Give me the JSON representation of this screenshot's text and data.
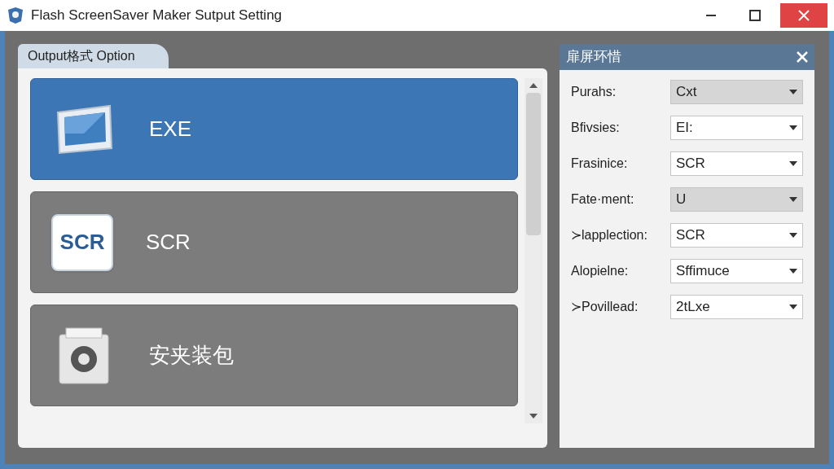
{
  "window": {
    "title": "Flash ScreenSaver Maker Sutput Setting"
  },
  "output_panel": {
    "tab": "Output格式 Option",
    "options": [
      {
        "kind": "monitor",
        "label": "EXE",
        "selected": true
      },
      {
        "kind": "scr",
        "icon_text": "SCR",
        "label": "SCR",
        "selected": false
      },
      {
        "kind": "package",
        "label": "安夹装包",
        "selected": false
      }
    ]
  },
  "settings_panel": {
    "title": "扉屏环惜",
    "fields": [
      {
        "label": "Purahs:",
        "value": "Cxt",
        "disabled": true
      },
      {
        "label": "Bfivsies:",
        "value": "EI:",
        "disabled": false
      },
      {
        "label": "Frasinice:",
        "value": "SCR",
        "disabled": false
      },
      {
        "label": "Fate·ment:",
        "value": "U",
        "disabled": true
      },
      {
        "label": "≻lapplection:",
        "value": "SCR",
        "disabled": false
      },
      {
        "label": "Alopielne:",
        "value": "Sffimuce",
        "disabled": false
      },
      {
        "label": "≻Povillead:",
        "value": "2tLxe",
        "disabled": false
      }
    ]
  }
}
